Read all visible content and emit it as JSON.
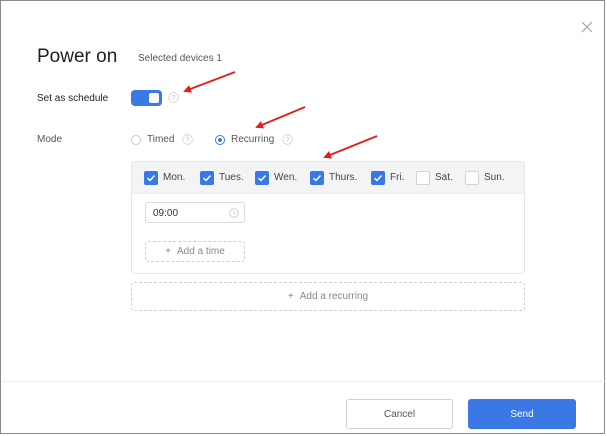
{
  "dialog": {
    "title": "Power on",
    "subtitle": "Selected devices 1"
  },
  "schedule": {
    "label": "Set as schedule",
    "enabled": true
  },
  "mode": {
    "label": "Mode",
    "options": [
      {
        "label": "Timed",
        "selected": false
      },
      {
        "label": "Recurring",
        "selected": true
      }
    ]
  },
  "days": [
    {
      "label": "Mon.",
      "checked": true
    },
    {
      "label": "Tues.",
      "checked": true
    },
    {
      "label": "Wen.",
      "checked": true
    },
    {
      "label": "Thurs.",
      "checked": true
    },
    {
      "label": "Fri.",
      "checked": true
    },
    {
      "label": "Sat.",
      "checked": false
    },
    {
      "label": "Sun.",
      "checked": false
    }
  ],
  "time": {
    "value": "09:00"
  },
  "actions": {
    "add_time": "Add a time",
    "add_recurring": "Add a recurring",
    "cancel": "Cancel",
    "send": "Send"
  },
  "colors": {
    "accent": "#3a78e6",
    "annotation": "#e02020"
  },
  "icons": {
    "close": "close-icon",
    "help": "question-circle-icon",
    "clock": "clock-icon",
    "plus": "plus-icon",
    "check": "check-icon"
  }
}
